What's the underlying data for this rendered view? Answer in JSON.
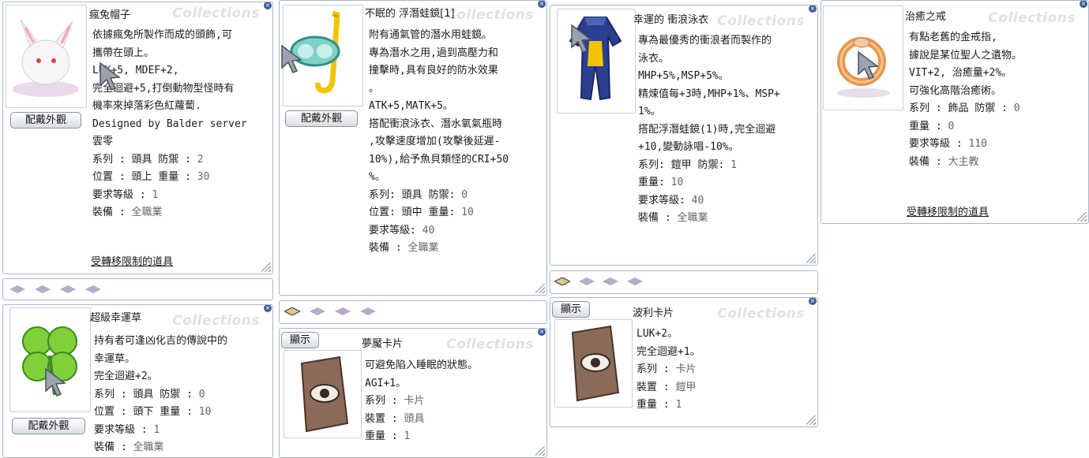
{
  "watermark": "Collections",
  "close_glyph": "×",
  "footer_label": "受轉移限制的道具",
  "button_equip_label": "配戴外觀",
  "button_show_label": "顯示",
  "windows": [
    {
      "title": "瘋兔帽子",
      "icon": "rabbit-hat-icon",
      "lines": [
        "依據瘋兔所製作而成的頭飾,可",
        "攜帶在頭上。",
        "LUK+5, MDEF+2,",
        "完全迴避+5,打倒動物型怪時有",
        "機率來掉落彩色紅蘿蔔.",
        "Designed by Balder server",
        "雲零"
      ],
      "props": [
        {
          "label": "系列 : 頭具 防禦 :",
          "value": "2"
        },
        {
          "label": "位置 : 頭上 重量 :",
          "value": "30"
        },
        {
          "label": "要求等級 :",
          "value": "1"
        },
        {
          "label": "裝備 :",
          "value": "全職業"
        }
      ]
    },
    {
      "title": "不眠的 浮潛蛙鏡[1]",
      "icon": "snorkel-goggles-icon",
      "lines": [
        "附有通氣管的潛水用蛙鏡。",
        "專為潛水之用,過到高壓力和",
        "撞擊時,具有良好的防水效果",
        "。",
        "ATK+5,MATK+5。",
        "搭配衝浪泳衣、潛水氧氣瓶時",
        ",攻擊速度增加(攻擊後延遲-",
        "10%),給予魚貝類怪的CRI+50",
        "%。"
      ],
      "props": [
        {
          "label": "系列: 頭具 防禦:",
          "value": "0"
        },
        {
          "label": "位置: 頭中 重量:",
          "value": "10"
        },
        {
          "label": "要求等級:",
          "value": "40"
        },
        {
          "label": "裝備 :",
          "value": "全職業"
        }
      ]
    },
    {
      "title": "幸運的 衝浪泳衣",
      "icon": "wetsuit-icon",
      "lines": [
        "專為最優秀的衝浪者而製作的",
        "泳衣。",
        "MHP+5%,MSP+5%。",
        "精煉值每+3時,MHP+1%、MSP+",
        "1%。",
        "搭配浮潛蛙鏡(1)時,完全迴避",
        "+10,變動詠唱-10%。"
      ],
      "props": [
        {
          "label": "系列: 鎧甲 防禦:",
          "value": "1"
        },
        {
          "label": "重量:",
          "value": "10"
        },
        {
          "label": "要求等級:",
          "value": "40"
        },
        {
          "label": "裝備 :",
          "value": "全職業"
        }
      ]
    },
    {
      "title": "治癒之戒",
      "icon": "gold-ring-icon",
      "lines": [
        "有點老舊的金戒指,",
        "據說是某位聖人之遺物。",
        "VIT+2, 治癒量+2%。",
        "可強化高階治癒術。"
      ],
      "props": [
        {
          "label": "系列 : 飾品 防禦 :",
          "value": "0"
        },
        {
          "label": "重量 :",
          "value": "0"
        },
        {
          "label": "要求等級 :",
          "value": "110"
        },
        {
          "label": "裝備 :",
          "value": "大主教"
        }
      ]
    },
    {
      "title": "超級幸運草",
      "icon": "four-leaf-clover-icon",
      "lines": [
        "持有者可逢凶化吉的傳說中的",
        "幸運草。",
        "完全迴避+2。"
      ],
      "props": [
        {
          "label": "系列 : 頭具 防禦 :",
          "value": "0"
        },
        {
          "label": "位置 : 頭下  重量 :",
          "value": "10"
        },
        {
          "label": "要求等級 :",
          "value": "1"
        },
        {
          "label": "裝備 :",
          "value": "全職業"
        }
      ]
    },
    {
      "title": "夢魘卡片",
      "icon": "nightmare-card-icon",
      "lines": [
        "可避免陷入睡眠的狀態。",
        "AGI+1。"
      ],
      "props": [
        {
          "label": "系列 :",
          "value": "卡片"
        },
        {
          "label": "裝置 :",
          "value": "頭具"
        },
        {
          "label": "重量 :",
          "value": "1"
        }
      ]
    },
    {
      "title": "波利卡片",
      "icon": "poring-card-icon",
      "lines": [
        "LUK+2。",
        "完全迴避+1。"
      ],
      "props": [
        {
          "label": "系列 :",
          "value": "卡片"
        },
        {
          "label": "裝置 :",
          "value": "鎧甲"
        },
        {
          "label": "重量 :",
          "value": "1"
        }
      ]
    }
  ],
  "colors": {
    "border": "#a9b6c6",
    "watermark": "#dde1e6",
    "close": "#3a5f9a",
    "slot": "#b9a9c4",
    "text": "#1a1a1a",
    "value": "#666666"
  }
}
